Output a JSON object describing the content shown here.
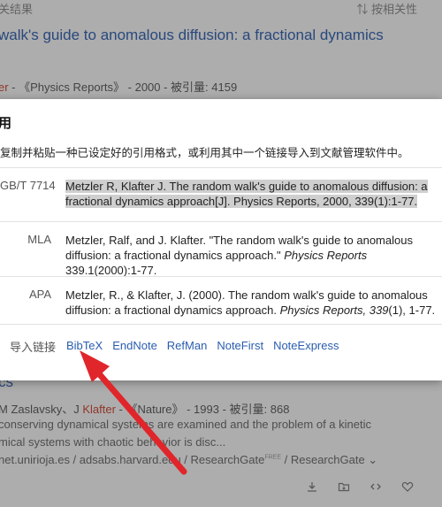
{
  "background": {
    "top_left_text": "关结果",
    "sort_label": "按相关性",
    "result1": {
      "title": "walk's guide to anomalous diffusion: a fractional dynamics",
      "meta_author": "er",
      "meta_rest": " - 《Physics Reports》 - 2000 - 被引量: 4159"
    },
    "result2": {
      "title": "cs",
      "meta_prefix": "M Zaslavsky、J ",
      "meta_author": "Klafter",
      "meta_rest": " - 《Nature》 - 1993 - 被引量: 868",
      "snippet_line1": "conserving dynamical systems are examined and the problem of a kinetic",
      "snippet_line2": "mical systems with chaotic behavior is disc...",
      "sources_main": "net.unirioja.es / adsabs.harvard.edu / ResearchGate",
      "sources_badge": "FREE",
      "sources_tail": " / ResearchGate"
    },
    "action_icons": [
      "download-icon",
      "folder-icon",
      "code-icon",
      "heart-icon"
    ]
  },
  "dialog": {
    "title": "用",
    "description": "复制并粘贴一种已设定好的引用格式，或利用其中一个链接导入到文献管理软件中。",
    "citations": {
      "gbt": {
        "format": "GB/T 7714",
        "text": "Metzler R, Klafter J. The random walk's guide to anomalous diffusion: a fractional dynamics approach[J]. Physics Reports, 2000, 339(1):1-77."
      },
      "mla": {
        "format": "MLA",
        "text_a": "Metzler, Ralf, and J. Klafter. \"The random walk's guide to anomalous diffusion: a fractional dynamics approach.\" ",
        "journal": "Physics Reports",
        "text_b": " 339.1(2000):1-77."
      },
      "apa": {
        "format": "APA",
        "text_a": "Metzler, R., & Klafter, J. (2000). The random walk's guide to anomalous diffusion: a fractional dynamics approach. ",
        "journal": "Physics Reports, 339",
        "text_b": "(1), 1-77."
      }
    },
    "import": {
      "label": "导入链接",
      "links": [
        "BibTeX",
        "EndNote",
        "RefMan",
        "NoteFirst",
        "NoteExpress"
      ]
    }
  },
  "colors": {
    "link": "#2a5db0",
    "author_red": "#d0402b",
    "annotation_arrow": "#e0262b"
  }
}
